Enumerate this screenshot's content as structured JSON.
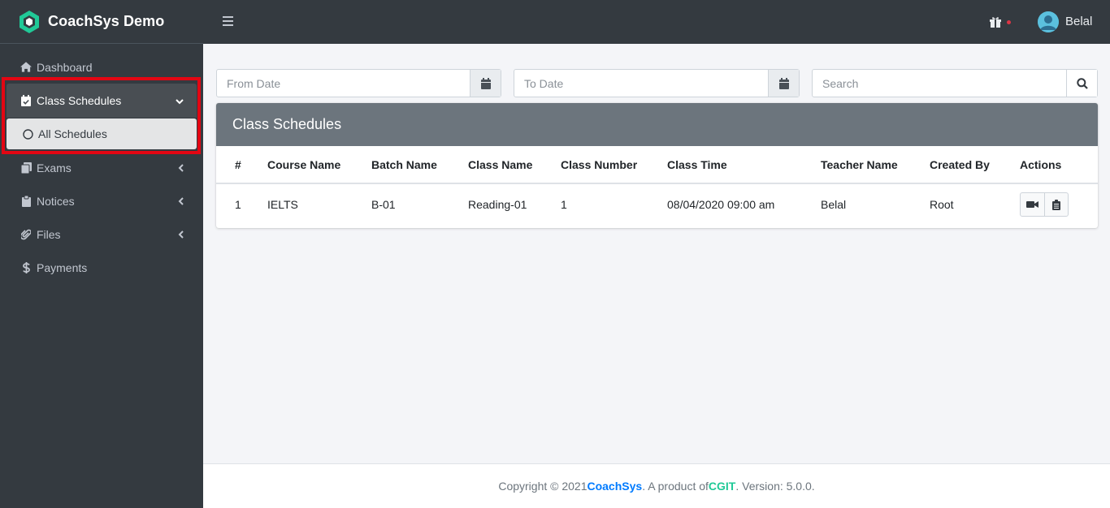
{
  "app": {
    "name": "CoachSys Demo",
    "accent": "#20c997"
  },
  "sidebar": {
    "items": [
      {
        "label": "Dashboard",
        "icon": "home-icon"
      },
      {
        "label": "Class Schedules",
        "icon": "calendar-check-icon",
        "caret": "chevron-down-icon"
      },
      {
        "label": "All Schedules",
        "icon": "circle-icon"
      },
      {
        "label": "Exams",
        "icon": "copy-icon",
        "caret": "chevron-left-icon"
      },
      {
        "label": "Notices",
        "icon": "clipboard-icon",
        "caret": "chevron-left-icon"
      },
      {
        "label": "Files",
        "icon": "paperclip-icon",
        "caret": "chevron-left-icon"
      },
      {
        "label": "Payments",
        "icon": "dollar-icon"
      }
    ],
    "highlight_color": "#e30613"
  },
  "topbar": {
    "user_name": "Belal",
    "notification_color": "#dc3545"
  },
  "filters": {
    "from_placeholder": "From Date",
    "to_placeholder": "To Date",
    "search_placeholder": "Search"
  },
  "card": {
    "title": "Class Schedules",
    "columns": [
      "#",
      "Course Name",
      "Batch Name",
      "Class Name",
      "Class Number",
      "Class Time",
      "Teacher Name",
      "Created By",
      "Actions"
    ],
    "rows": [
      [
        "1",
        "IELTS",
        "B-01",
        "Reading-01",
        "1",
        "08/04/2020 09:00 am",
        "Belal",
        "Root"
      ]
    ]
  },
  "footer": {
    "prefix": "Copyright © 2021 ",
    "brand": "CoachSys",
    "middle": ". A product of ",
    "company": "CGIT",
    "suffix": ". Version: 5.0.0."
  }
}
